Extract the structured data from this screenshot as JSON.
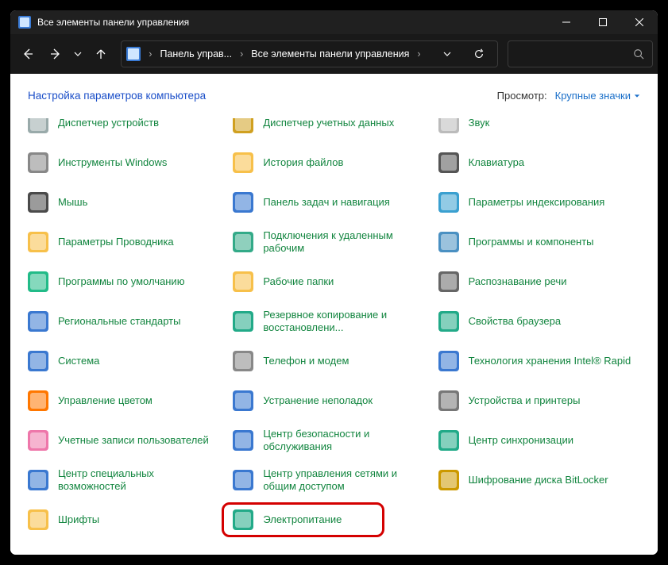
{
  "title": "Все элементы панели управления",
  "breadcrumbs": {
    "b1": "Панель управ...",
    "b2": "Все элементы панели управления"
  },
  "heading": "Настройка параметров компьютера",
  "viewLabel": "Просмотр:",
  "viewValue": "Крупные значки",
  "topcut": [
    {
      "label": " "
    },
    {
      "label": "Диспетчер учетных данных"
    },
    {
      "label": " "
    }
  ],
  "items": [
    {
      "label": "Диспетчер устройств",
      "iconBg": "#9aa"
    },
    {
      "label": "",
      "iconBg": "transparent"
    },
    {
      "label": "Звук",
      "iconBg": "#bbb"
    },
    {
      "label": "Инструменты Windows",
      "iconBg": "#888"
    },
    {
      "label": "История файлов",
      "iconBg": "#f7c04a"
    },
    {
      "label": "Клавиатура",
      "iconBg": "#555"
    },
    {
      "label": "Мышь",
      "iconBg": "#4a4a4a"
    },
    {
      "label": "Панель задач и навигация",
      "iconBg": "#3a78d0"
    },
    {
      "label": "Параметры индексирования",
      "iconBg": "#3aa0d0"
    },
    {
      "label": "Параметры Проводника",
      "iconBg": "#f7c04a"
    },
    {
      "label": "Подключения к удаленным рабочим",
      "iconBg": "#3a8"
    },
    {
      "label": "Программы и компоненты",
      "iconBg": "#4a90c2"
    },
    {
      "label": "Программы по умолчанию",
      "iconBg": "#2b8"
    },
    {
      "label": "Рабочие папки",
      "iconBg": "#f7c04a"
    },
    {
      "label": "Распознавание речи",
      "iconBg": "#666"
    },
    {
      "label": "Региональные стандарты",
      "iconBg": "#3a78d0"
    },
    {
      "label": "Резервное копирование и восстановлени...",
      "iconBg": "#2a8"
    },
    {
      "label": "Свойства браузера",
      "iconBg": "#2a8"
    },
    {
      "label": "Система",
      "iconBg": "#3a78d0"
    },
    {
      "label": "Телефон и модем",
      "iconBg": "#888"
    },
    {
      "label": "Технология хранения Intel® Rapid",
      "iconBg": "#3a78d0"
    },
    {
      "label": "Управление цветом",
      "iconBg": "#f70"
    },
    {
      "label": "Устранение неполадок",
      "iconBg": "#3a78d0"
    },
    {
      "label": "Устройства и принтеры",
      "iconBg": "#777"
    },
    {
      "label": "Учетные записи пользователей",
      "iconBg": "#e7a"
    },
    {
      "label": "Центр безопасности и обслуживания",
      "iconBg": "#3a78d0"
    },
    {
      "label": "Центр синхронизации",
      "iconBg": "#2a8"
    },
    {
      "label": "Центр специальных возможностей",
      "iconBg": "#3a78d0"
    },
    {
      "label": "Центр управления сетями и общим доступом",
      "iconBg": "#3a78d0"
    },
    {
      "label": "Шифрование диска BitLocker",
      "iconBg": "#c90"
    },
    {
      "label": "Шрифты",
      "iconBg": "#f7c04a"
    },
    {
      "label": "Электропитание",
      "iconBg": "#2a8",
      "highlight": true
    }
  ]
}
